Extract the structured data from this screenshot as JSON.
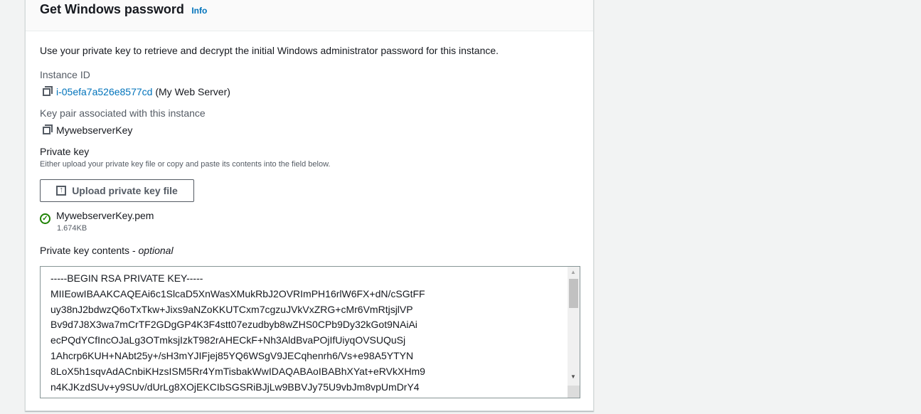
{
  "header": {
    "title": "Get Windows password",
    "info_link": "Info"
  },
  "description": "Use your private key to retrieve and decrypt the initial Windows administrator password for this instance.",
  "instance": {
    "label": "Instance ID",
    "id": "i-05efa7a526e8577cd",
    "name": "(My Web Server)",
    "icon": "copy-icon"
  },
  "key_pair": {
    "label": "Key pair associated with this instance",
    "value": "MywebserverKey",
    "icon": "copy-icon"
  },
  "private_key": {
    "label": "Private key",
    "hint": "Either upload your private key file or copy and paste its contents into the field below.",
    "upload_button": "Upload private key file",
    "file_name": "MywebserverKey.pem",
    "file_size": "1.674KB"
  },
  "contents": {
    "label": "Private key contents - ",
    "label_optional": "optional",
    "lines": [
      "-----BEGIN RSA PRIVATE KEY-----",
      "MIIEowIBAAKCAQEAi6c1SlcaD5XnWasXMukRbJ2OVRImPH16rlW6FX+dN/cSGtFF",
      "uy38nJ2bdwzQ6oTxTkw+Jixs9aNZoKKUTCxm7cgzuJVkVxZRG+cMr6VmRtjsjlVP",
      "Bv9d7J8X3wa7mCrTF2GDgGP4K3F4stt07ezudbyb8wZHS0CPb9Dy32kGot9NAiAi",
      "ecPQdYCfIncOJaLg3OTmksjIzkT982rAHECkF+Nh3AldBvaPOjIfUiyqOVSUQuSj",
      "1Ahcrp6KUH+NAbt25y+/sH3mYJIFjej85YQ6WSgV9JECqhenrh6/Vs+e98A5YTYN",
      "8LoX5h1sqvAdACnbiKHzsISM5Rr4YmTisbakWwIDAQABAoIBABhXYat+eRVkXHm9",
      "n4KJKzdSUv+y9SUv/dUrLg8XOjEKCIbSGSRiBJjLw9BBVJy75U9vbJm8vpUmDrY4"
    ]
  }
}
